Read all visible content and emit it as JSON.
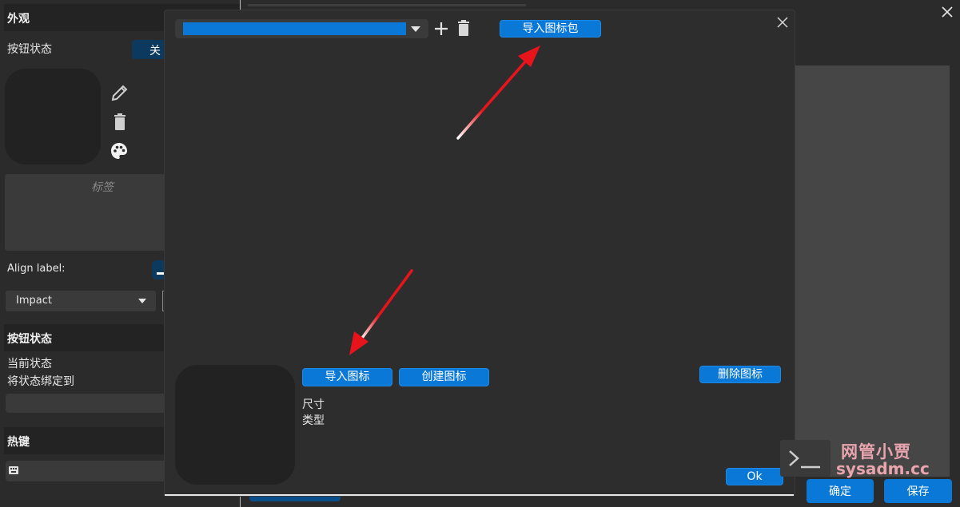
{
  "background": {
    "appearance_header": "外观",
    "button_state_label": "按钮状态",
    "toggle_value": "关",
    "label_placeholder": "标签",
    "align_label": "Align label:",
    "font_value": "Impact",
    "button_state_header": "按钮状态",
    "current_state_label": "当前状态",
    "bind_state_label": "将状态绑定到",
    "hotkey_header": "热键",
    "confirm_button": "确定",
    "save_button": "保存"
  },
  "dialog": {
    "import_pack_button": "导入图标包",
    "import_icon_button": "导入图标",
    "create_icon_button": "创建图标",
    "delete_icon_button": "删除图标",
    "size_label": "尺寸",
    "type_label": "类型",
    "ok_button": "Ok"
  },
  "watermark": {
    "line1": "网管小贾",
    "line2": "sysadm.cc"
  },
  "colors": {
    "accent": "#0a78d7",
    "arrow": "#e8141b",
    "watermark": "#e9a5ae"
  },
  "icons": [
    "pencil-icon",
    "trash-icon",
    "palette-icon",
    "keyboard-icon",
    "plus-icon",
    "close-icon",
    "terminal-icon"
  ]
}
